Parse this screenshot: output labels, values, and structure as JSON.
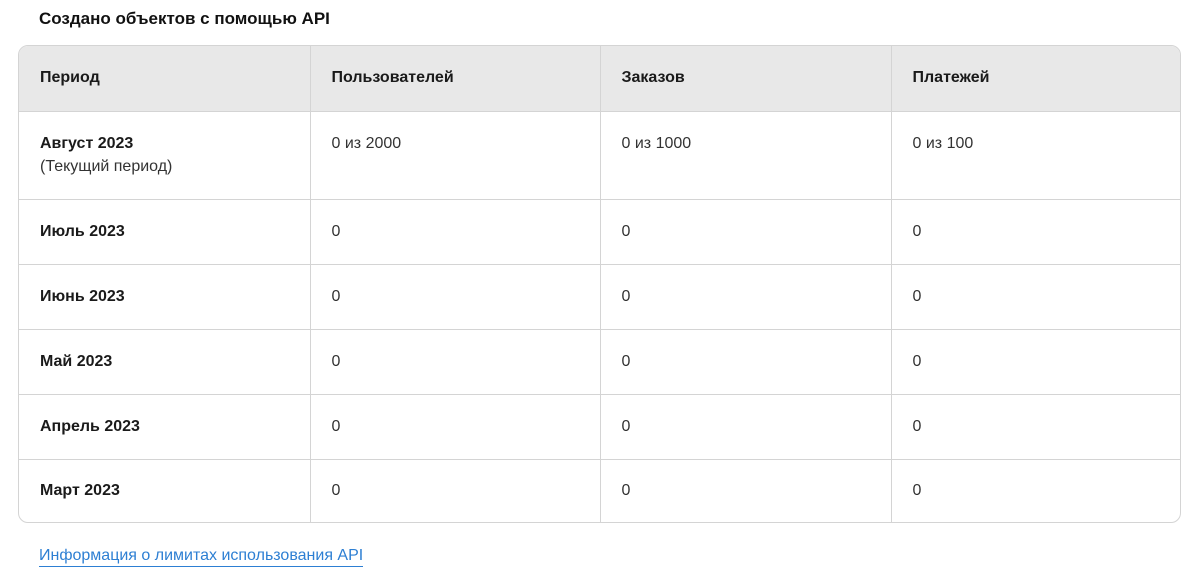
{
  "section": {
    "title": "Создано объектов с помощью API"
  },
  "table": {
    "headers": [
      "Период",
      "Пользователей",
      "Заказов",
      "Платежей"
    ],
    "rows": [
      {
        "period": "Август 2023",
        "sub": "(Текущий период)",
        "users": "0 из 2000",
        "orders": "0 из 1000",
        "payments": "0 из 100"
      },
      {
        "period": "Июль 2023",
        "sub": "",
        "users": "0",
        "orders": "0",
        "payments": "0"
      },
      {
        "period": "Июнь 2023",
        "sub": "",
        "users": "0",
        "orders": "0",
        "payments": "0"
      },
      {
        "period": "Май 2023",
        "sub": "",
        "users": "0",
        "orders": "0",
        "payments": "0"
      },
      {
        "period": "Апрель 2023",
        "sub": "",
        "users": "0",
        "orders": "0",
        "payments": "0"
      },
      {
        "period": "Март 2023",
        "sub": "",
        "users": "0",
        "orders": "0",
        "payments": "0"
      }
    ]
  },
  "footer": {
    "link_label": "Информация о лимитах использования API"
  },
  "colors": {
    "header_bg": "#e8e8e8",
    "border": "#d4d4d4",
    "link": "#2d7fd3"
  }
}
